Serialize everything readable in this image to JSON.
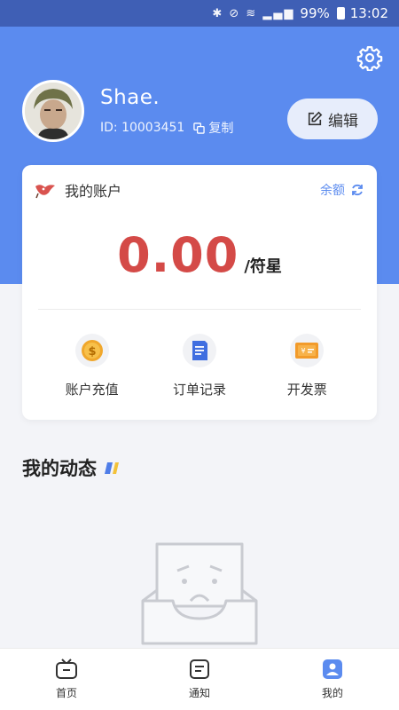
{
  "status_bar": {
    "icons": "✱ ⊘ ≋ ▂▄▆",
    "battery": "99%",
    "time": "13:02"
  },
  "profile": {
    "username": "Shae.",
    "user_id": "ID: 10003451",
    "copy_label": "复制",
    "edit_label": "编辑"
  },
  "account": {
    "title": "我的账户",
    "balance_link": "余额",
    "balance_value": "0.00",
    "balance_unit": "/符星",
    "actions": [
      {
        "label": "账户充值",
        "icon": "coin-icon"
      },
      {
        "label": "订单记录",
        "icon": "document-icon"
      },
      {
        "label": "开发票",
        "icon": "invoice-icon"
      }
    ]
  },
  "section": {
    "title": "我的动态"
  },
  "tabs": [
    {
      "label": "首页",
      "icon": "tv-icon"
    },
    {
      "label": "通知",
      "icon": "notice-icon"
    },
    {
      "label": "我的",
      "icon": "profile-icon",
      "active": true
    }
  ],
  "colors": {
    "primary": "#5b8bef",
    "balance": "#d44a47",
    "status_bar": "#3f5fb5"
  }
}
